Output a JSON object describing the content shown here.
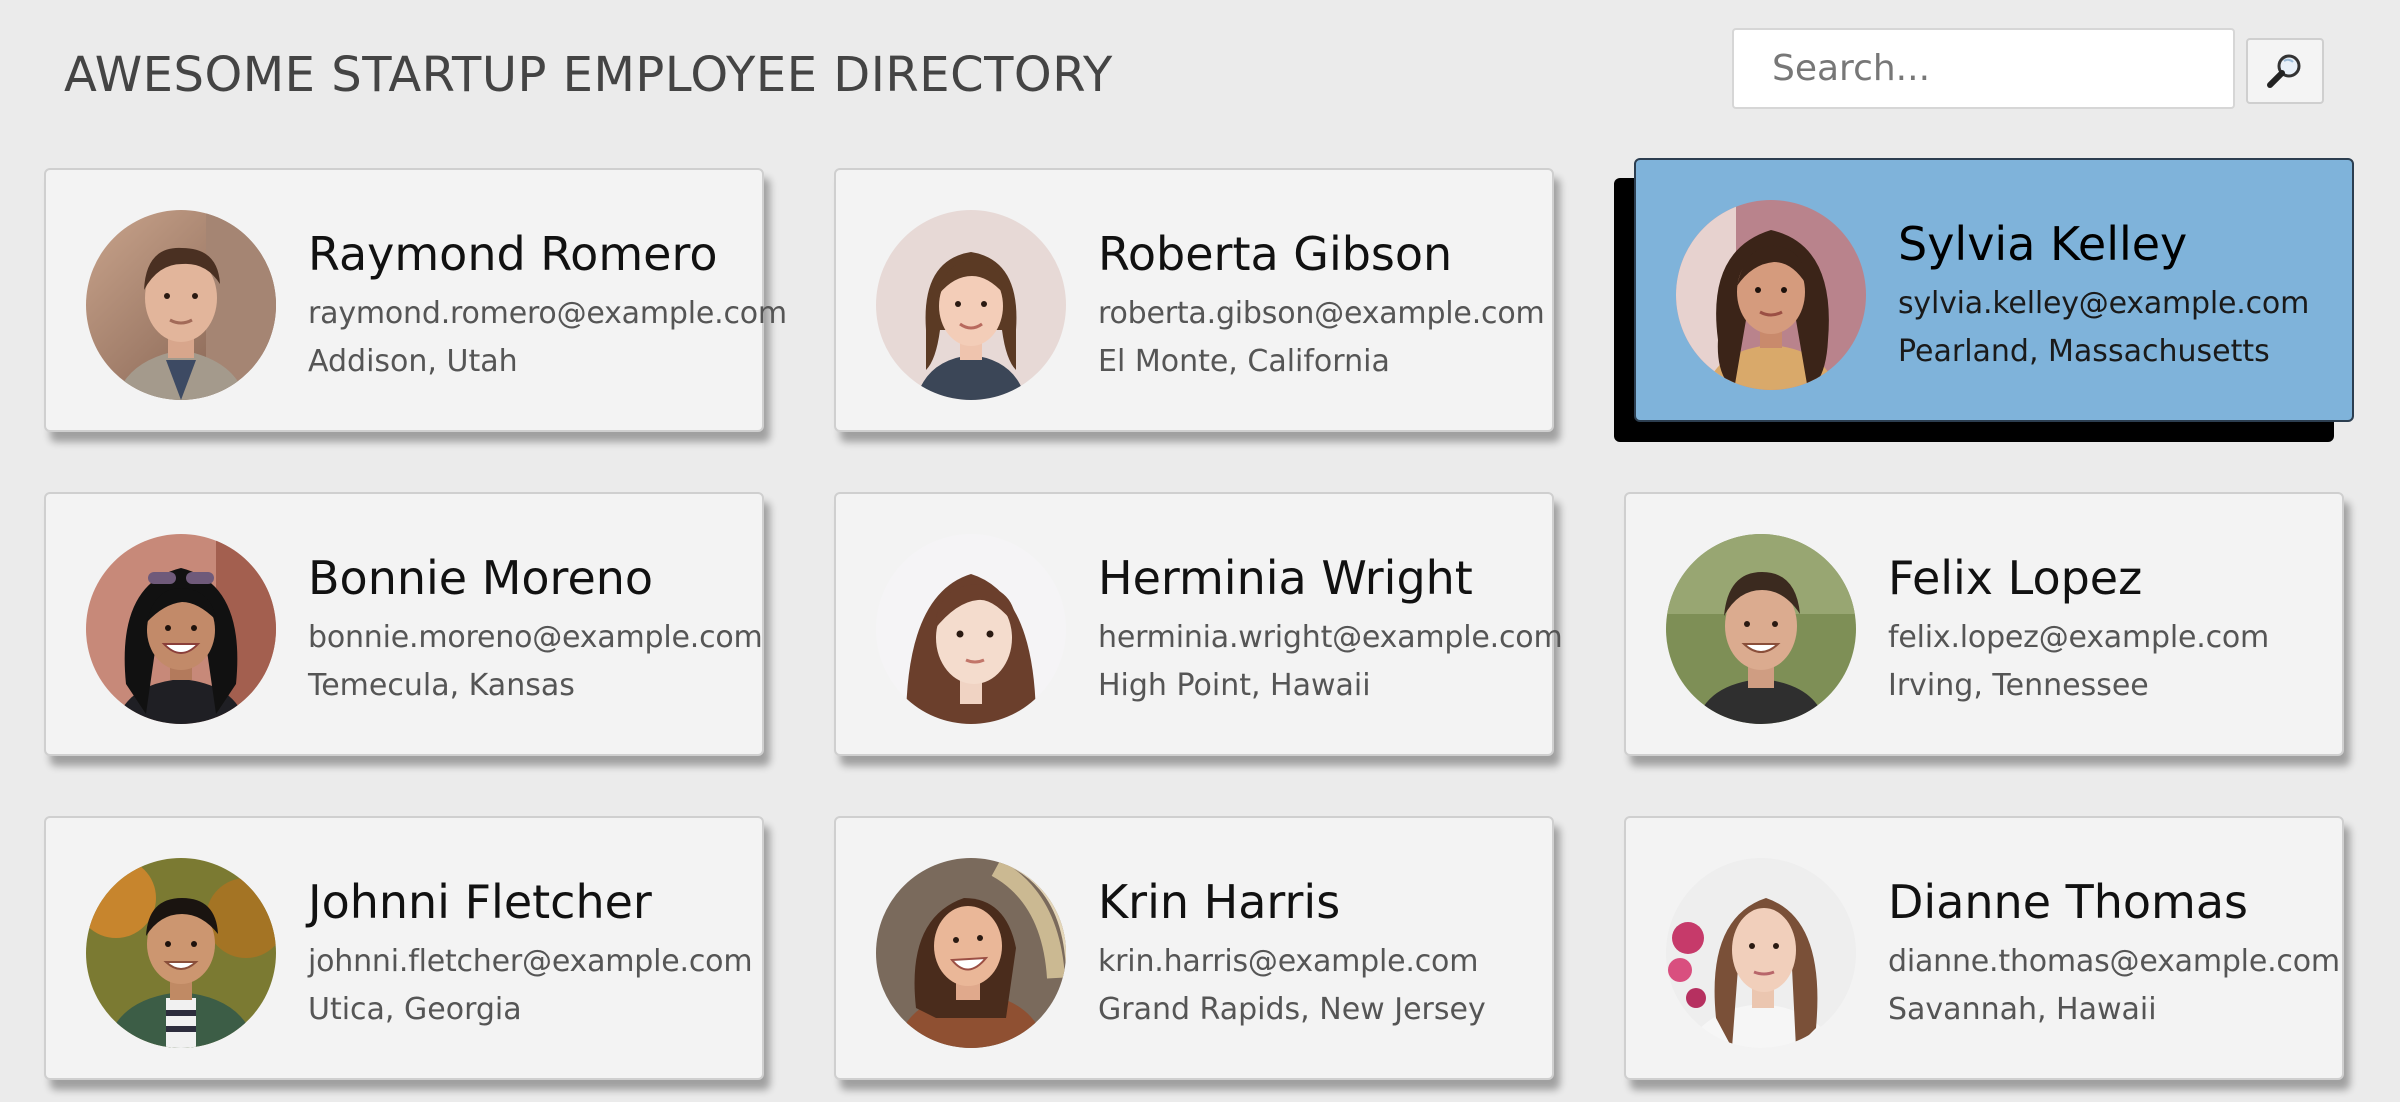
{
  "header": {
    "title": "AWESOME STARTUP EMPLOYEE DIRECTORY"
  },
  "search": {
    "placeholder": "Search...",
    "button_icon": "magnifier-icon"
  },
  "employees": [
    {
      "name": "Raymond Romero",
      "email": "raymond.romero@example.com",
      "location": "Addison, Utah"
    },
    {
      "name": "Roberta Gibson",
      "email": "roberta.gibson@example.com",
      "location": "El Monte, California"
    },
    {
      "name": "Sylvia Kelley",
      "email": "sylvia.kelley@example.com",
      "location": "Pearland, Massachusetts"
    },
    {
      "name": "Bonnie Moreno",
      "email": "bonnie.moreno@example.com",
      "location": "Temecula, Kansas"
    },
    {
      "name": "Herminia Wright",
      "email": "herminia.wright@example.com",
      "location": "High Point, Hawaii"
    },
    {
      "name": "Felix Lopez",
      "email": "felix.lopez@example.com",
      "location": "Irving, Tennessee"
    },
    {
      "name": "Johnni Fletcher",
      "email": "johnni.fletcher@example.com",
      "location": "Utica, Georgia"
    },
    {
      "name": "Krin Harris",
      "email": "krin.harris@example.com",
      "location": "Grand Rapids, New Jersey"
    },
    {
      "name": "Dianne Thomas",
      "email": "dianne.thomas@example.com",
      "location": "Savannah, Hawaii"
    }
  ],
  "colors": {
    "page_background": "#ebebeb",
    "card_background": "#f3f3f3",
    "selected_card_background": "#7fb3da",
    "title_text": "#444444"
  }
}
